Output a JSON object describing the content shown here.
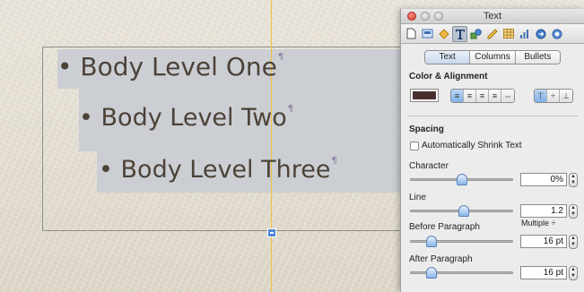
{
  "canvas": {
    "lines": [
      {
        "bullet": "•",
        "text": "Body Level One",
        "pilcrow": "¶"
      },
      {
        "bullet": "•",
        "text": "Body Level Two",
        "pilcrow": "¶"
      },
      {
        "bullet": "•",
        "text": "Body Level Three",
        "pilcrow": "¶"
      }
    ]
  },
  "inspector": {
    "title": "Text",
    "tabs": [
      {
        "label": "Text",
        "active": true
      },
      {
        "label": "Columns",
        "active": false
      },
      {
        "label": "Bullets",
        "active": false
      }
    ],
    "color_alignment": {
      "heading": "Color & Alignment",
      "text_color": "#4a2e2e"
    },
    "spacing": {
      "heading": "Spacing",
      "auto_shrink_label": "Automatically Shrink Text",
      "auto_shrink_checked": false,
      "character": {
        "label": "Character",
        "value": "0%",
        "level": 0.5
      },
      "line": {
        "label": "Line",
        "value": "1.2",
        "mode": "Multiple",
        "level": 0.52
      },
      "before_paragraph": {
        "label": "Before Paragraph",
        "value": "16 pt",
        "level": 0.17
      },
      "after_paragraph": {
        "label": "After Paragraph",
        "value": "16 pt",
        "level": 0.17
      }
    }
  }
}
